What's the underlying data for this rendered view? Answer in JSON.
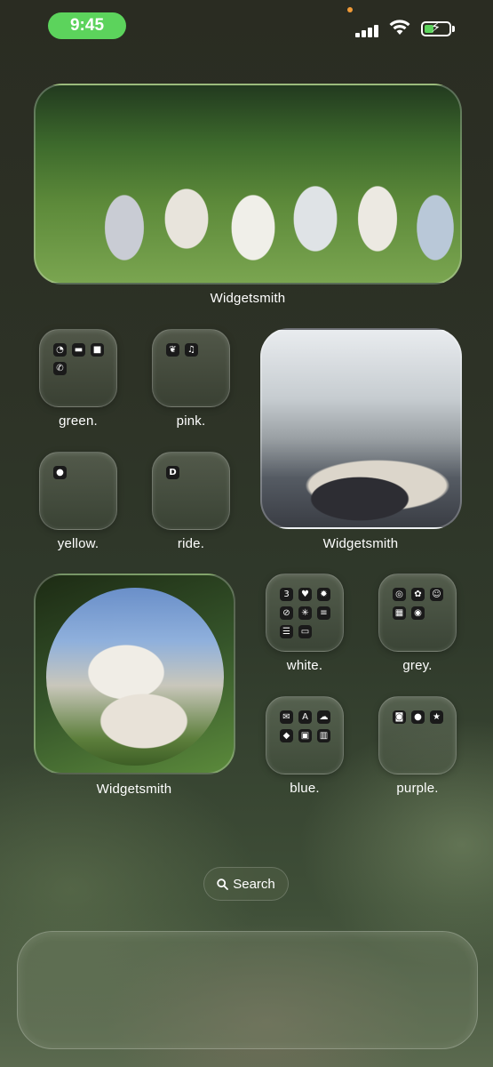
{
  "status_bar": {
    "time": "9:45"
  },
  "widgets": {
    "top": {
      "label": "Widgetsmith"
    },
    "right": {
      "label": "Widgetsmith"
    },
    "circle": {
      "label": "Widgetsmith"
    }
  },
  "folders": {
    "green": {
      "label": "green.",
      "icons": [
        "whatsapp-icon",
        "messages-icon",
        "facetime-icon",
        "phone-icon"
      ]
    },
    "pink": {
      "label": "pink.",
      "icons": [
        "leaf-icon",
        "music-icon"
      ]
    },
    "yellow": {
      "label": "yellow.",
      "icons": [
        "bulb-icon"
      ]
    },
    "ride": {
      "label": "ride.",
      "icons": [
        "id-icon"
      ]
    },
    "white": {
      "label": "white.",
      "icons": [
        "calendar-icon",
        "health-icon",
        "settings-icon",
        "compass-icon",
        "clock-icon",
        "wallet-icon",
        "reminders-icon",
        "files-icon"
      ]
    },
    "grey": {
      "label": "grey.",
      "icons": [
        "chrome-icon",
        "openai-icon",
        "contacts-icon",
        "calculator-icon",
        "podcast-icon"
      ]
    },
    "blue": {
      "label": "blue.",
      "icons": [
        "mail-icon",
        "appstore-icon",
        "cloud-icon",
        "layers-icon",
        "photos-icon",
        "library-icon"
      ]
    },
    "purple": {
      "label": "purple.",
      "icons": [
        "instagram-icon",
        "podcasts-icon",
        "star-icon"
      ]
    }
  },
  "search": {
    "label": "Search"
  },
  "colors": {
    "time_pill": "#5cd35c",
    "status_dot": "#f09a37"
  }
}
